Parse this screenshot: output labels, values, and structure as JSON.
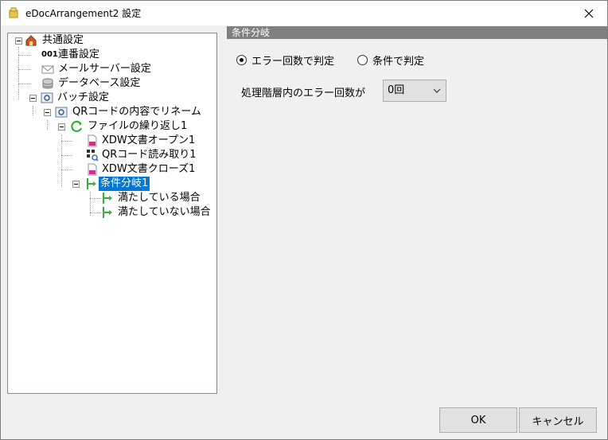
{
  "window": {
    "title": "eDocArrangement2 設定",
    "close_glyph": "✕"
  },
  "tree": {
    "root": "共通設定",
    "renban": "連番設定",
    "renban_prefix": "001",
    "mail": "メールサーバー設定",
    "database": "データベース設定",
    "batch": "バッチ設定",
    "qr_rename": "QRコードの内容でリネーム",
    "file_loop": "ファイルの繰り返し1",
    "xdw_open": "XDW文書オープン1",
    "qr_read": "QRコード読み取り1",
    "xdw_close": "XDW文書クローズ1",
    "branch": "条件分岐1",
    "satisfied": "満たしている場合",
    "not_satisfied": "満たしていない場合"
  },
  "panel": {
    "header": "条件分岐",
    "radio_error_count": "エラー回数で判定",
    "radio_condition": "条件で判定",
    "selected_radio": "radio_error_count",
    "error_count_label": "処理階層内のエラー回数が",
    "error_count_value": "0回"
  },
  "buttons": {
    "ok": "OK",
    "cancel": "キャンセル"
  },
  "colors": {
    "selection": "#0078d7",
    "header_bg": "#808080",
    "branch_green": "#2fb52f"
  }
}
